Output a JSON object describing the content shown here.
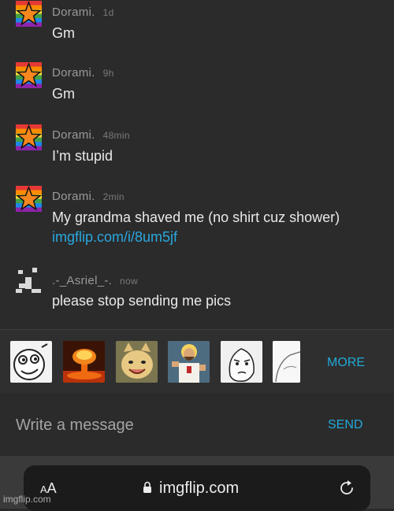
{
  "messages": [
    {
      "user": "Dorami.",
      "time": "1d",
      "text": "Gm"
    },
    {
      "user": "Dorami.",
      "time": "9h",
      "text": "Gm"
    },
    {
      "user": "Dorami.",
      "time": "48min",
      "text": "I’m stupid"
    },
    {
      "user": "Dorami.",
      "time": "2min",
      "text": "My grandma shaved me (no shirt cuz shower)",
      "link": "imgflip.com/i/8um5jf"
    },
    {
      "user": ".-_Asriel_-.",
      "time": "now",
      "text": "please stop sending me pics"
    }
  ],
  "meme_bar": {
    "memes": [
      "rage-face-meme",
      "nuke-explosion-meme",
      "smiling-cat-meme",
      "buddy-christ-meme",
      "okay-guy-meme",
      "partial-meme"
    ],
    "more_label": "MORE"
  },
  "compose": {
    "placeholder": "Write a message",
    "send_label": "SEND"
  },
  "browser": {
    "text_size_small": "A",
    "text_size_large": "A",
    "url": "imgflip.com"
  },
  "watermark": "imgflip.com",
  "colors": {
    "background": "#2b2b2b",
    "accent": "#22a9d8",
    "link": "#29a8e0",
    "text": "#e9e9e9",
    "muted": "#9a9a9a"
  }
}
